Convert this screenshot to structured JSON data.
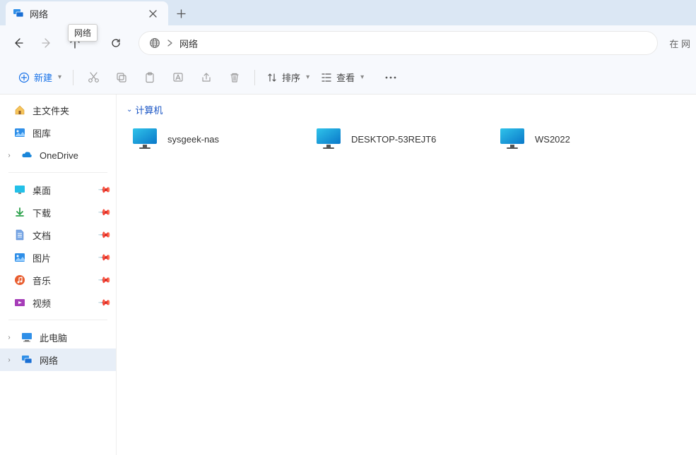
{
  "tab": {
    "title": "网络",
    "tooltip": "网络"
  },
  "address": {
    "location": "网络"
  },
  "search": {
    "hint": "在 网"
  },
  "toolbar": {
    "new_label": "新建",
    "sort_label": "排序",
    "view_label": "查看"
  },
  "sidebar": {
    "home": "主文件夹",
    "gallery": "图库",
    "onedrive": "OneDrive",
    "quick": {
      "desktop": "桌面",
      "downloads": "下载",
      "documents": "文档",
      "pictures": "图片",
      "music": "音乐",
      "videos": "视频"
    },
    "this_pc": "此电脑",
    "network": "网络"
  },
  "main": {
    "group_label": "计算机",
    "computers": [
      {
        "name": "sysgeek-nas"
      },
      {
        "name": "DESKTOP-53REJT6"
      },
      {
        "name": "WS2022"
      }
    ]
  }
}
